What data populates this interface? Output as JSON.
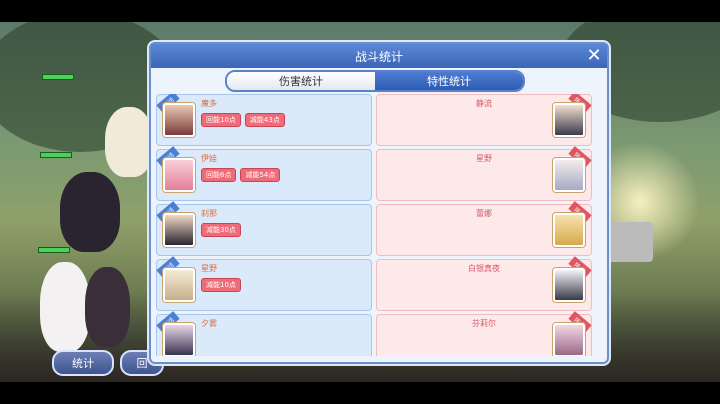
{
  "dialog": {
    "title": "战斗统计",
    "close_label": "✕",
    "tabs": [
      {
        "label": "伤害统计",
        "active": false
      },
      {
        "label": "特性统计",
        "active": true
      }
    ]
  },
  "ally_badge": "存活",
  "enemy_badge": "阵亡",
  "rows": [
    {
      "ally": {
        "name": "魔多",
        "tags": [
          "回能10点",
          "减能43点"
        ]
      },
      "enemy": {
        "name": "静流"
      }
    },
    {
      "ally": {
        "name": "伊娃",
        "tags": [
          "回能6点",
          "减能54点"
        ]
      },
      "enemy": {
        "name": "星野"
      }
    },
    {
      "ally": {
        "name": "刹那",
        "tags": [
          "减能30点"
        ]
      },
      "enemy": {
        "name": "蕾娜"
      }
    },
    {
      "ally": {
        "name": "星野",
        "tags": [
          "减能10点"
        ]
      },
      "enemy": {
        "name": "白银真夜"
      }
    },
    {
      "ally": {
        "name": "夕雾",
        "tags": []
      },
      "enemy": {
        "name": "芬莉尔"
      }
    }
  ],
  "bottom_buttons": {
    "stats": "统计",
    "back": "回"
  },
  "colors": {
    "ally_card": "#dbeafa",
    "enemy_card": "#fde9ea",
    "tag": "#ef6b78",
    "title_bar": "#3b66b8"
  }
}
